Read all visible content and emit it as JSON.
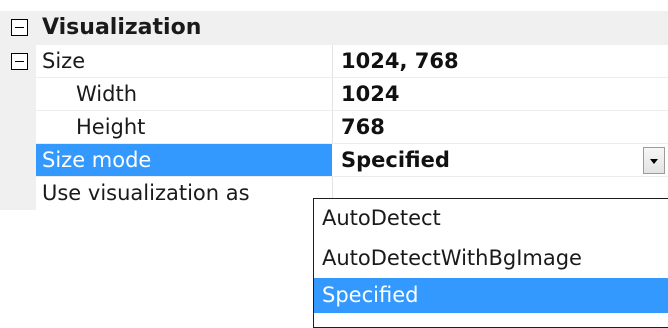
{
  "category": {
    "label": "Visualization"
  },
  "properties": [
    {
      "name": "Size",
      "value": "1024, 768",
      "expandable": true
    },
    {
      "name": "Width",
      "value": "1024"
    },
    {
      "name": "Height",
      "value": "768"
    },
    {
      "name": "Size mode",
      "value": "Specified",
      "selected": true
    },
    {
      "name": "Use visualization as",
      "value": ""
    }
  ],
  "dropdown": {
    "options": [
      "AutoDetect",
      "AutoDetectWithBgImage",
      "Specified"
    ],
    "selected_index": 2
  },
  "colors": {
    "selection": "#3399ff",
    "category_bg": "#f0f0f0"
  }
}
